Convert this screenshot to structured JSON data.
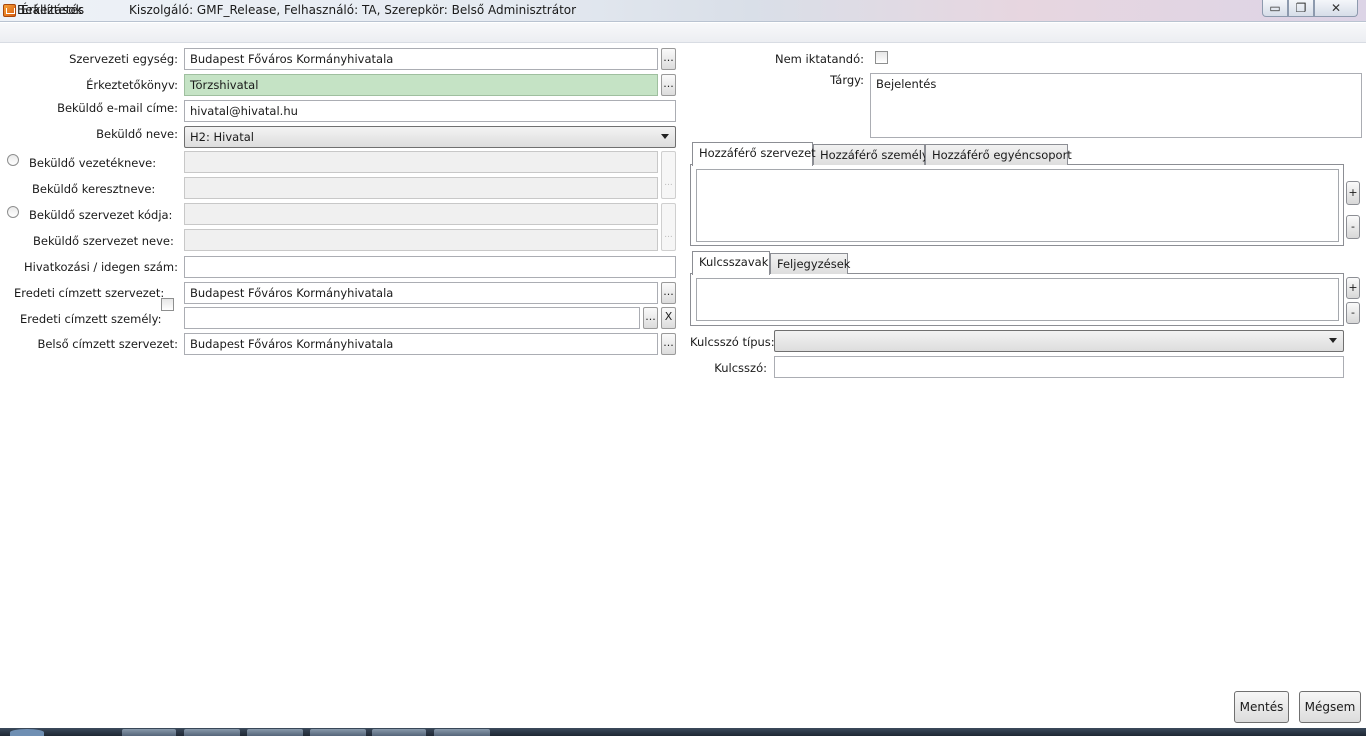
{
  "window": {
    "title": "Érkeztetés",
    "server_info": "Kiszolgáló: GMF_Release,  Felhasználó: TA,  Szerepkör: Belső Adminisztrátor",
    "min_glyph": "▭",
    "max_glyph": "❐",
    "close_glyph": "✕"
  },
  "menu": {
    "settings": "Beállítások"
  },
  "form": {
    "org_unit_label": "Szervezeti egység:",
    "org_unit_value": "Budapest Főváros Kormányhivatala",
    "registry_book_label": "Érkeztetőkönyv:",
    "registry_book_value": "Törzshivatal",
    "sender_email_label": "Beküldő e-mail címe:",
    "sender_email_value": "hivatal@hivatal.hu",
    "sender_name_label": "Beküldő neve:",
    "sender_name_value": "H2: Hivatal",
    "sender_lastname_label": "Beküldő vezetékneve:",
    "sender_firstname_label": "Beküldő keresztneve:",
    "sender_org_code_label": "Beküldő szervezet kódja:",
    "sender_org_name_label": "Beküldő szervezet neve:",
    "reference_number_label": "Hivatkozási / idegen szám:",
    "orig_recipient_org_label": "Eredeti címzett szervezet:",
    "orig_recipient_org_value": "Budapest Főváros Kormányhivatala",
    "orig_recipient_person_label": "Eredeti címzett személy:",
    "internal_recipient_org_label": "Belső címzett szervezet:",
    "internal_recipient_org_value": "Budapest Főváros Kormányhivatala",
    "dots": "...",
    "clear": "X"
  },
  "right": {
    "not_filed_label": "Nem iktatandó:",
    "subject_label": "Tárgy:",
    "subject_value": "Bejelentés",
    "access_tabs": [
      "Hozzáférő szervezet",
      "Hozzáférő személy",
      "Hozzáférő egyéncsoport"
    ],
    "keyword_tabs": [
      "Kulcsszavak",
      "Feljegyzések"
    ],
    "plus": "+",
    "minus": "-",
    "keyword_type_label": "Kulcsszó típus:",
    "keyword_label": "Kulcsszó:"
  },
  "buttons": {
    "save": "Mentés",
    "cancel": "Mégsem"
  }
}
